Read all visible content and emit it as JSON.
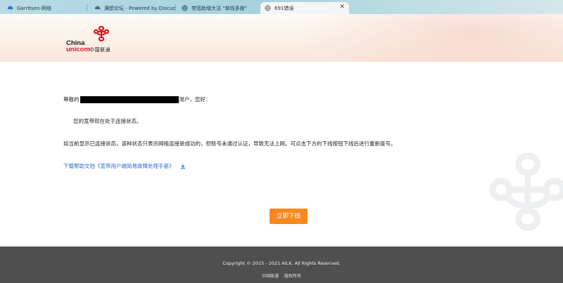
{
  "tabs": [
    {
      "title": "Garritsen-网络",
      "icon": "cloud-icon"
    },
    {
      "title": "满想论坛 - Powered by Discuz!",
      "icon": "cloud-icon"
    },
    {
      "title": "带宽助增大法 \"单线多拨\"",
      "icon": "globe-icon"
    },
    {
      "title": "691错误",
      "icon": "globe-icon",
      "active": true,
      "close": "✕"
    }
  ],
  "header": {
    "logo": {
      "line1": "China",
      "line2": "unicom",
      "cn": "中国联通"
    }
  },
  "main": {
    "greeting_prefix": "尊敬的",
    "greeting_suffix": "用户，您好：",
    "status_text": "您的宽带现在处于连接状态。",
    "info_text": "如当前显示已连接状态，该种状态只表示网络连接是成功的，但账号未通过认证，导致无法上网。可点击下方的下线按钮下线后进行重新拨号。",
    "help_link": "下载帮助文档《宽带用户端简易故障处理手册》",
    "download_icon": "download-icon",
    "action_button": "立即下线"
  },
  "footer": {
    "copyright": "Copyright © 2015 - 2021 AILK. All Rights Reserved.",
    "links": [
      "中国联通",
      "版权所有"
    ]
  },
  "colors": {
    "accent_button": "#f5891f",
    "link": "#2a6fc9",
    "brand_red": "#d71920",
    "footer_bg": "#4f4f4f"
  }
}
